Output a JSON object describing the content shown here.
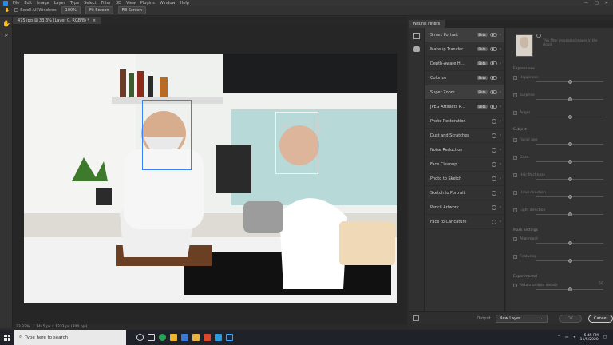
{
  "app": {
    "menu": [
      "File",
      "Edit",
      "Image",
      "Layer",
      "Type",
      "Select",
      "Filter",
      "3D",
      "View",
      "Plugins",
      "Window",
      "Help"
    ],
    "window_controls": [
      "—",
      "□",
      "✕"
    ]
  },
  "options_bar": {
    "checkbox_label": "Scroll All Windows",
    "zoom_value": "100%",
    "fit_screen": "Fit Screen",
    "fill_screen": "Fill Screen"
  },
  "document": {
    "tab_title": "475.jpg @ 33.3% (Layer 0, RGB/8) *",
    "tab_close": "×",
    "status_zoom": "33.33%",
    "status_info": "1445 px x 1333 px (300 ppi)"
  },
  "neural_filters": {
    "panel_title": "Neural Filters",
    "items": [
      {
        "name": "Smart Portrait",
        "badge": "Beta",
        "toggle": true,
        "active": true
      },
      {
        "name": "Makeup Transfer",
        "badge": "Beta",
        "toggle": true,
        "active": false
      },
      {
        "name": "Depth-Aware H...",
        "badge": "Beta",
        "toggle": true,
        "active": false
      },
      {
        "name": "Colorize",
        "badge": "Beta",
        "toggle": true,
        "active": false
      },
      {
        "name": "Super Zoom",
        "badge": "Beta",
        "toggle": true,
        "active": true
      },
      {
        "name": "JPEG Artifacts R...",
        "badge": "Beta",
        "toggle": true,
        "active": false
      },
      {
        "name": "Photo Restoration",
        "badge": "",
        "toggle": false,
        "active": false
      },
      {
        "name": "Dust and Scratches",
        "badge": "",
        "toggle": false,
        "active": false
      },
      {
        "name": "Noise Reduction",
        "badge": "",
        "toggle": false,
        "active": false
      },
      {
        "name": "Face Cleanup",
        "badge": "",
        "toggle": false,
        "active": false
      },
      {
        "name": "Photo to Sketch",
        "badge": "",
        "toggle": false,
        "active": false
      },
      {
        "name": "Sketch to Portrait",
        "badge": "",
        "toggle": false,
        "active": false
      },
      {
        "name": "Pencil Artwork",
        "badge": "",
        "toggle": false,
        "active": false
      },
      {
        "name": "Face to Caricature",
        "badge": "",
        "toggle": false,
        "active": false
      }
    ],
    "settings": {
      "desc": "This filter processes images in the cloud.",
      "section_expressions": "Expressions",
      "section_global": "Subject",
      "section_mask": "Mask settings",
      "section_experimental": "Experimental",
      "sliders_1": [
        {
          "label": "Happiness",
          "value": 0
        },
        {
          "label": "Surprise",
          "value": 0
        },
        {
          "label": "Anger",
          "value": 0
        }
      ],
      "sliders_2": [
        {
          "label": "Facial age",
          "value": 0
        },
        {
          "label": "Gaze",
          "value": 0
        },
        {
          "label": "Hair thickness",
          "value": 0
        },
        {
          "label": "Head direction",
          "value": 0
        },
        {
          "label": "Light direction",
          "value": 0
        }
      ],
      "sliders_3": [
        {
          "label": "Alignment",
          "value": 0
        },
        {
          "label": "Featuring",
          "value": 0
        }
      ],
      "experimental_label": "Retain unique details",
      "experimental_value": "50"
    },
    "output_label": "Output",
    "output_value": "New Layer",
    "ok_label": "OK",
    "cancel_label": "Cancel"
  },
  "taskbar": {
    "search_placeholder": "Type here to search",
    "time": "5:45 PM",
    "date": "11/5/2020"
  }
}
